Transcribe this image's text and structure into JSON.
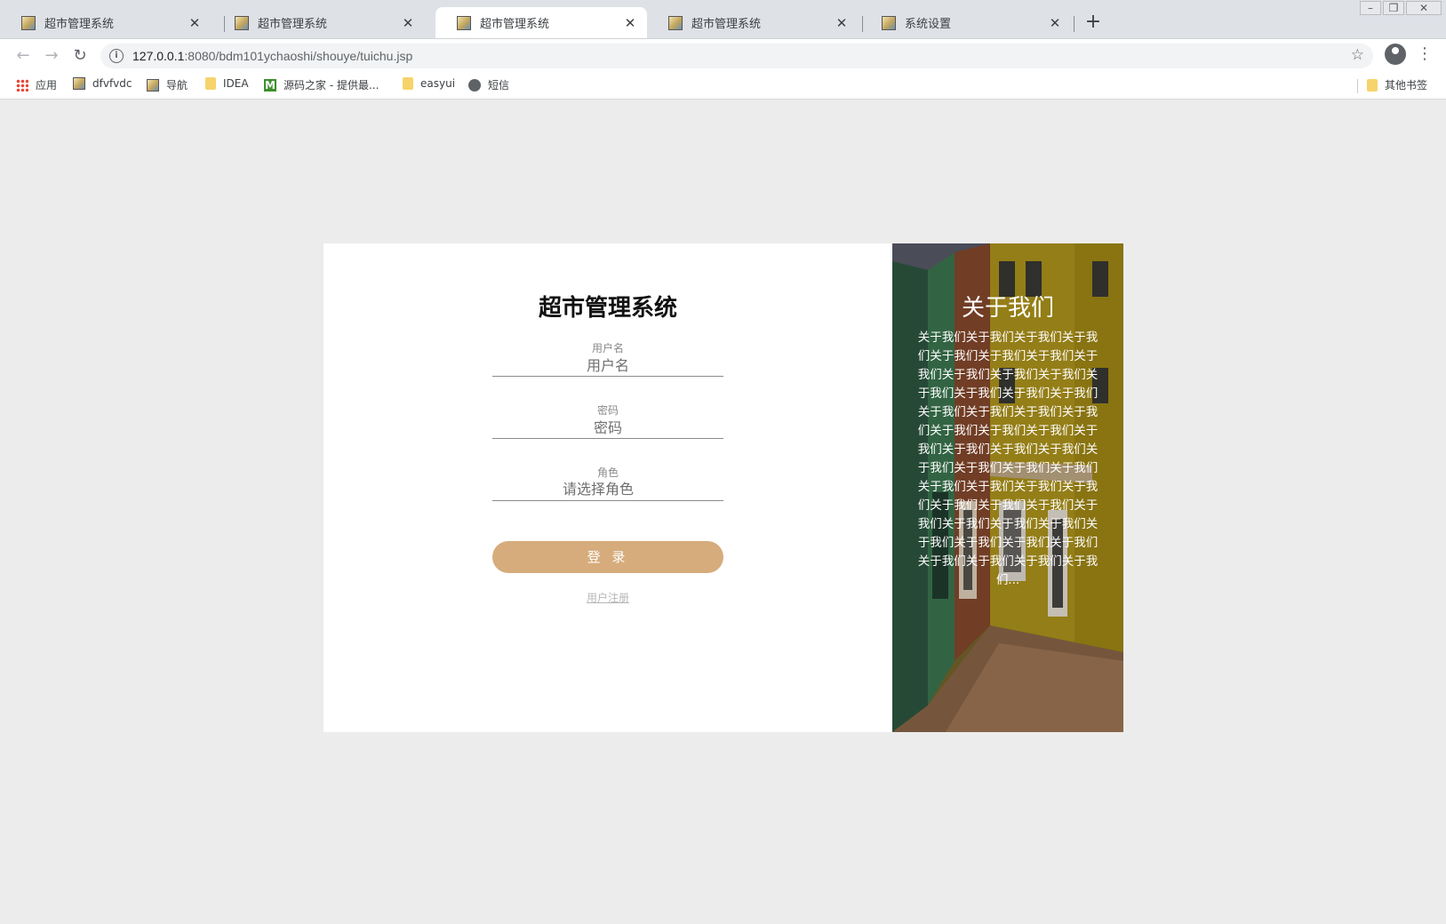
{
  "browser": {
    "tabs": [
      {
        "title": "超市管理系统",
        "active": false
      },
      {
        "title": "超市管理系统",
        "active": false
      },
      {
        "title": "超市管理系统",
        "active": true
      },
      {
        "title": "超市管理系统",
        "active": false
      },
      {
        "title": "系统设置",
        "active": false
      }
    ],
    "new_tab_label": "+",
    "url_host": "127.0.0.1",
    "url_path": ":8080/bdm101ychaoshi/shouye/tuichu.jsp",
    "bookmarks": [
      {
        "label": "应用",
        "icon": "apps-icon"
      },
      {
        "label": "dfvfvdc",
        "icon": "image-icon"
      },
      {
        "label": "导航",
        "icon": "image-icon"
      },
      {
        "label": "IDEA",
        "icon": "folder-icon"
      },
      {
        "label": "源码之家 - 提供最...",
        "icon": "m-icon"
      },
      {
        "label": "easyui",
        "icon": "folder-icon"
      },
      {
        "label": "短信",
        "icon": "globe-icon"
      }
    ],
    "other_bookmarks": "其他书签"
  },
  "login": {
    "title": "超市管理系统",
    "username_label": "用户名",
    "username_placeholder": "用户名",
    "password_label": "密码",
    "password_placeholder": "密码",
    "role_label": "角色",
    "role_value": "请选择角色",
    "submit_label": "登 录",
    "register_link": "用户注册",
    "button_color": "#d6ac7c"
  },
  "about": {
    "title": "关于我们",
    "text": "关于我们关于我们关于我们关于我们关于我们关于我们关于我们关于我们关于我们关于我们关于我们关于我们关于我们关于我们关于我们关于我们关于我们关于我们关于我们关于我们关于我们关于我们关于我们关于我们关于我们关于我们关于我们关于我们关于我们关于我们关于我们关于我们关于我们关于我们关于我们关于我们关于我们关于我们关于我们关于我们关于我们关于我们关于我们关于我们关于我们关于我们关于我们关于我们关于我们..."
  }
}
